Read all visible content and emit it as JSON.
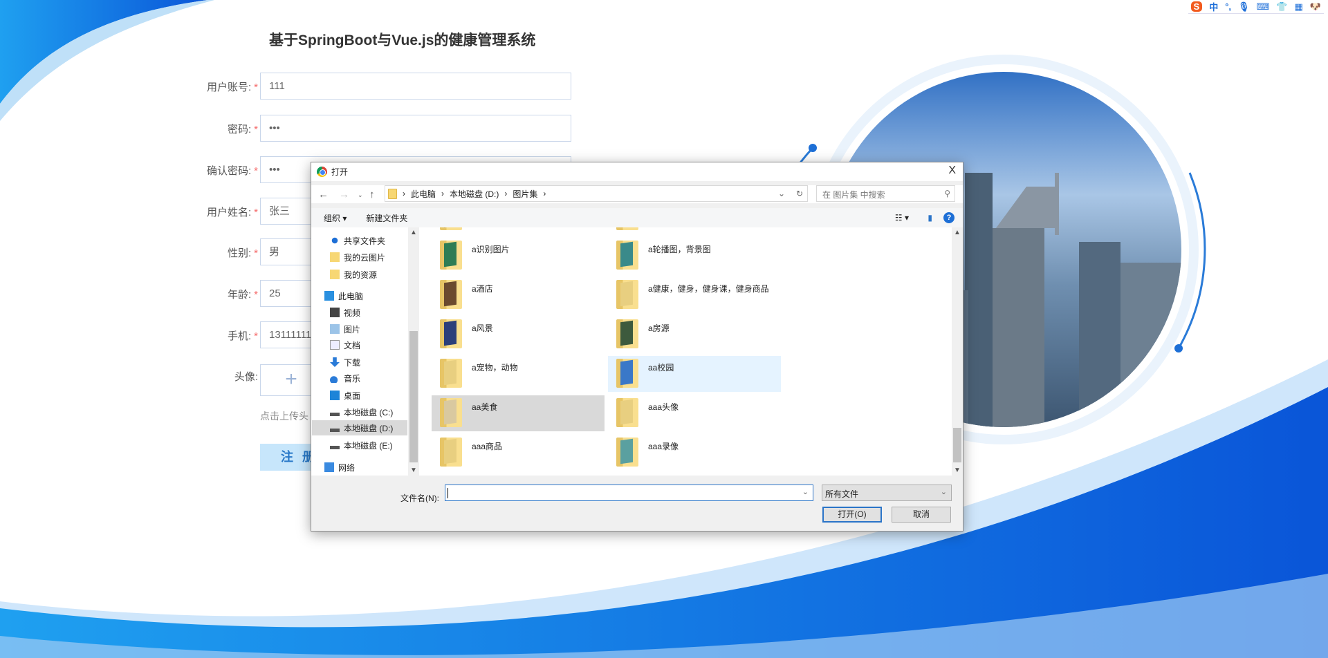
{
  "page": {
    "title": "基于SpringBoot与Vue.js的健康管理系统",
    "colors": {
      "accent": "#1565e0",
      "required": "#f56c6c",
      "button_bg": "#c7e6fb"
    }
  },
  "form": {
    "fields": [
      {
        "label": "用户账号:",
        "required": "*",
        "value": "111"
      },
      {
        "label": "密码:",
        "required": "*",
        "value": "•••"
      },
      {
        "label": "确认密码:",
        "required": "*",
        "value": "•••"
      },
      {
        "label": "用户姓名:",
        "required": "*",
        "value": "张三"
      },
      {
        "label": "性别:",
        "required": "*",
        "value": "男"
      },
      {
        "label": "年龄:",
        "required": "*",
        "value": "25"
      },
      {
        "label": "手机:",
        "required": "*",
        "value": "13111111"
      }
    ],
    "avatar_label": "头像:",
    "avatar_plus": "+",
    "avatar_hint": "点击上传头",
    "submit": "注 册"
  },
  "ime_bar": {
    "logo": "S",
    "items": [
      "中",
      "°,",
      "mic-icon",
      "keyboard-icon",
      "shirt-icon",
      "grid-icon",
      "mascot-icon"
    ],
    "lang": "中",
    "punct": "°,"
  },
  "dialog": {
    "title": "打开",
    "close": "X",
    "path": [
      "此电脑",
      "本地磁盘 (D:)",
      "图片集"
    ],
    "search_placeholder": "在 图片集 中搜索",
    "toolbar": {
      "organize": "组织 ▾",
      "new_folder": "新建文件夹"
    },
    "nav": [
      {
        "label": "共享文件夹",
        "icon": "share-icon"
      },
      {
        "label": "我的云图片",
        "icon": "folder-icon"
      },
      {
        "label": "我的资源",
        "icon": "folder-icon"
      },
      {
        "label": "此电脑",
        "icon": "computer-icon"
      },
      {
        "label": "视频",
        "icon": "video-icon"
      },
      {
        "label": "图片",
        "icon": "picture-icon"
      },
      {
        "label": "文档",
        "icon": "document-icon"
      },
      {
        "label": "下载",
        "icon": "download-icon"
      },
      {
        "label": "音乐",
        "icon": "music-icon"
      },
      {
        "label": "桌面",
        "icon": "desktop-icon"
      },
      {
        "label": "本地磁盘 (C:)",
        "icon": "drive-icon"
      },
      {
        "label": "本地磁盘 (D:)",
        "icon": "drive-icon",
        "selected": true
      },
      {
        "label": "本地磁盘 (E:)",
        "icon": "drive-icon"
      },
      {
        "label": "网络",
        "icon": "network-icon"
      }
    ],
    "files": [
      {
        "name": "",
        "color": "#8a7a6a"
      },
      {
        "name": "",
        "color": "#e8cf80"
      },
      {
        "name": "a识别图片",
        "color": "#2e7d55"
      },
      {
        "name": "a轮播图，背景图",
        "color": "#3a8a8a"
      },
      {
        "name": "a酒店",
        "color": "#6b4a2e"
      },
      {
        "name": "a健康，健身，健身课，健身商品",
        "color": "#e8cf80"
      },
      {
        "name": "a风景",
        "color": "#2c3f7a"
      },
      {
        "name": "a房源",
        "color": "#3d5a3d"
      },
      {
        "name": "a宠物，动物",
        "color": "#e8cf80"
      },
      {
        "name": "aa校园",
        "color": "#3a78c8",
        "state": "hover"
      },
      {
        "name": "aa美食",
        "color": "#d9c9a0",
        "state": "selected"
      },
      {
        "name": "aaa头像",
        "color": "#e8cf80"
      },
      {
        "name": "aaa商品",
        "color": "#e8cf80"
      },
      {
        "name": "aaa录像",
        "color": "#5aa0a0"
      }
    ],
    "filename_label": "文件名(N):",
    "filename_value": "",
    "filter": "所有文件",
    "open": "打开(O)",
    "cancel": "取消"
  }
}
